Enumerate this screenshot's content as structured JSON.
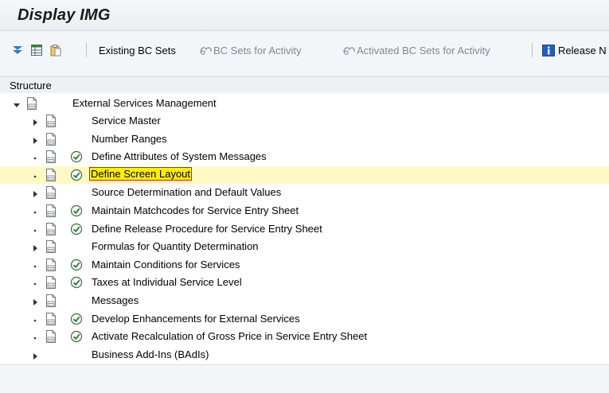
{
  "window": {
    "title": "Display IMG"
  },
  "toolbar": {
    "existing_bc_sets": "Existing BC Sets",
    "bc_sets_for_activity": "BC Sets for Activity",
    "activated_bc_sets": "Activated BC Sets for Activity",
    "release_notes": "Release N"
  },
  "structure": {
    "header": "Structure",
    "root": {
      "label": "External Services Management",
      "expanded": true
    },
    "items": [
      {
        "label": "Service Master",
        "type": "folder"
      },
      {
        "label": "Number Ranges",
        "type": "folder"
      },
      {
        "label": "Define Attributes of System Messages",
        "type": "activity"
      },
      {
        "label": "Define Screen Layout",
        "type": "activity",
        "selected": true
      },
      {
        "label": "Source Determination and Default Values",
        "type": "folder"
      },
      {
        "label": "Maintain Matchcodes for Service Entry Sheet",
        "type": "activity"
      },
      {
        "label": "Define Release Procedure for Service Entry Sheet",
        "type": "activity"
      },
      {
        "label": "Formulas for Quantity Determination",
        "type": "folder"
      },
      {
        "label": "Maintain Conditions for Services",
        "type": "activity"
      },
      {
        "label": "Taxes at Individual Service Level",
        "type": "activity"
      },
      {
        "label": "Messages",
        "type": "folder"
      },
      {
        "label": "Develop Enhancements for External Services",
        "type": "activity"
      },
      {
        "label": "Activate Recalculation of Gross Price in Service Entry Sheet",
        "type": "activity"
      },
      {
        "label": "Business Add-Ins (BAdIs)",
        "type": "folder-noicon"
      }
    ]
  },
  "colors": {
    "selected_row": "#fff9c4",
    "highlight": "#ffee00",
    "highlight_border": "#e11919",
    "activity_icon": "#1f7a2e"
  }
}
